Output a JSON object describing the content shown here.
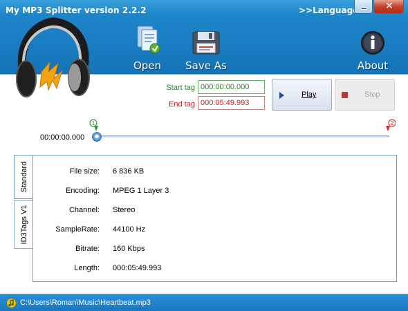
{
  "window": {
    "title": "My MP3 Splitter version 2.2.2",
    "language_link": ">>Language",
    "minimize_icon": "minimize-icon",
    "close_icon": "close-icon"
  },
  "toolbar": {
    "open_label": "Open",
    "save_as_label": "Save As",
    "about_label": "About",
    "logo_icon": "headphones-logo-icon"
  },
  "tags": {
    "start_label": "Start tag",
    "start_value": "000:00:00.000",
    "end_label": "End tag",
    "end_value": "000:05:49.993"
  },
  "controls": {
    "play_label": "Play",
    "stop_label": "Stop"
  },
  "timeline": {
    "position_label": "00:00:00.000",
    "marker_start_number": "1",
    "marker_end_number": "2",
    "position_fraction": 0.0
  },
  "tabs": [
    {
      "label": "Standard"
    },
    {
      "label": "ID3Tags V1"
    }
  ],
  "properties": [
    {
      "key": "File size:",
      "value": "6 836 KB"
    },
    {
      "key": "Encoding:",
      "value": "MPEG 1 Layer 3"
    },
    {
      "key": "Channel:",
      "value": "Stereo"
    },
    {
      "key": "SampleRate:",
      "value": "44100 Hz"
    },
    {
      "key": "Bitrate:",
      "value": "160 Kbps"
    },
    {
      "key": "Length:",
      "value": "000:05:49.993"
    }
  ],
  "status": {
    "path": "C:\\Users\\Roman\\Music\\Heartbeat.mp3"
  },
  "colors": {
    "header_blue": "#1a7ec2",
    "start_green": "#2a7c2a",
    "end_red": "#c41e1e",
    "close_red": "#c7402a"
  }
}
